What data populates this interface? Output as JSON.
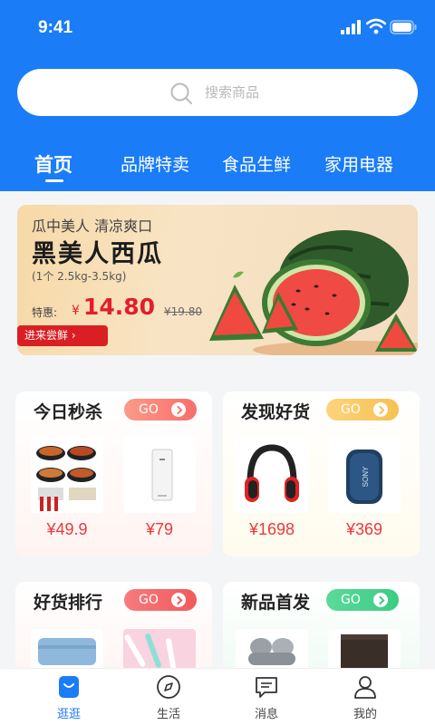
{
  "status_bar": {
    "time": "9:41"
  },
  "search": {
    "placeholder": "搜索商品"
  },
  "tabs": [
    {
      "label": "首页",
      "active": true
    },
    {
      "label": "品牌特卖"
    },
    {
      "label": "食品生鲜"
    },
    {
      "label": "家用电器"
    }
  ],
  "banner": {
    "subtitle": "瓜中美人 清凉爽口",
    "title": "黑美人西瓜",
    "spec": "(1个 2.5kg-3.5kg)",
    "price_label": "特惠:",
    "currency": "¥",
    "price": "14.80",
    "original_price": "¥19.80",
    "cta": "进来尝鲜",
    "image": "watermelon-image"
  },
  "sections": [
    {
      "title": "今日秒杀",
      "go": "GO",
      "go_color": "#f97a6f",
      "items": [
        {
          "image": "instant-noodle-image",
          "price": "¥49.9"
        },
        {
          "image": "power-bank-image",
          "price": "¥79"
        }
      ]
    },
    {
      "title": "发现好货",
      "go": "GO",
      "go_color": "#f6c14f",
      "items": [
        {
          "image": "headphones-image",
          "price": "¥1698"
        },
        {
          "image": "speaker-image",
          "price": "¥369"
        }
      ]
    },
    {
      "title": "好货排行",
      "go": "GO",
      "go_color": "#f15a5c",
      "items": [
        {
          "image": "towel-image"
        },
        {
          "image": "toothbrush-image"
        }
      ]
    },
    {
      "title": "新品首发",
      "go": "GO",
      "go_color": "#3ccc84",
      "items": [
        {
          "image": "earbuds-image"
        },
        {
          "image": "wallet-image"
        }
      ]
    }
  ],
  "tabbar": [
    {
      "label": "逛逛",
      "icon": "shopping-bag-icon",
      "active": true
    },
    {
      "label": "生活",
      "icon": "compass-icon"
    },
    {
      "label": "消息",
      "icon": "message-icon"
    },
    {
      "label": "我的",
      "icon": "user-icon"
    }
  ],
  "colors": {
    "primary": "#1a7cf7",
    "price": "#ea3a3a",
    "banner_cta": "#d91f24"
  }
}
